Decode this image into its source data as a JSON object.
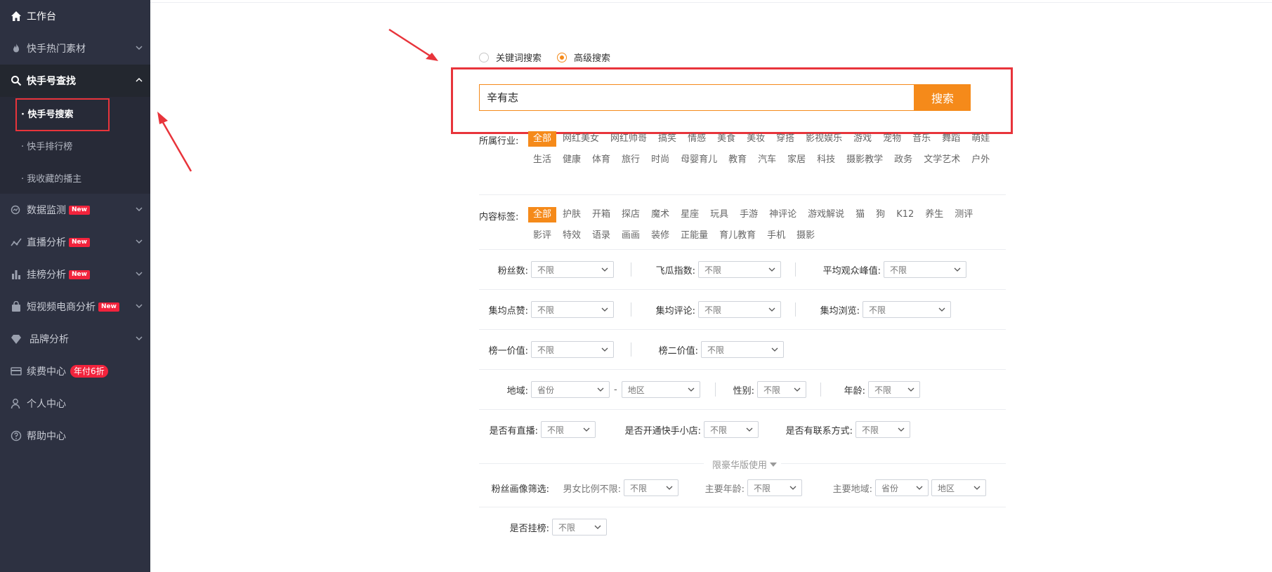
{
  "sidebar": {
    "items": [
      {
        "label": "工作台",
        "icon": "home-icon"
      },
      {
        "label": "快手热门素材",
        "icon": "fire-icon"
      },
      {
        "label": "快手号查找",
        "icon": "search-icon"
      },
      {
        "label": "数据监测",
        "icon": "monitor-icon",
        "badge": "New"
      },
      {
        "label": "直播分析",
        "icon": "trend-icon",
        "badge": "New"
      },
      {
        "label": "挂榜分析",
        "icon": "bar-chart-icon",
        "badge": "New"
      },
      {
        "label": "短视频电商分析",
        "icon": "shopping-bag-icon",
        "badge": "New"
      },
      {
        "label": "品牌分析",
        "icon": "diamond-icon"
      },
      {
        "label": "续费中心",
        "icon": "card-icon",
        "badge": "年付6折"
      },
      {
        "label": "个人中心",
        "icon": "user-icon"
      },
      {
        "label": "帮助中心",
        "icon": "help-icon"
      }
    ],
    "sub_items": [
      "· 快手号搜索",
      "· 快手排行榜",
      "· 我收藏的播主"
    ]
  },
  "search": {
    "mode_keyword": "关键词搜索",
    "mode_advanced": "高级搜索",
    "value": "辛有志",
    "button": "搜索"
  },
  "industry": {
    "label": "所属行业:",
    "tags": [
      "全部",
      "网红美女",
      "网红帅哥",
      "搞笑",
      "情感",
      "美食",
      "美妆",
      "穿搭",
      "影视娱乐",
      "游戏",
      "宠物",
      "音乐",
      "舞蹈",
      "萌娃",
      "生活",
      "健康",
      "体育",
      "旅行",
      "时尚",
      "母婴育儿",
      "教育",
      "汽车",
      "家居",
      "科技",
      "摄影教学",
      "政务",
      "文学艺术",
      "户外"
    ]
  },
  "content_tags": {
    "label": "内容标签:",
    "tags": [
      "全部",
      "护肤",
      "开箱",
      "探店",
      "魔术",
      "星座",
      "玩具",
      "手游",
      "神评论",
      "游戏解说",
      "猫",
      "狗",
      "K12",
      "养生",
      "测评",
      "影评",
      "特效",
      "语录",
      "画画",
      "装修",
      "正能量",
      "育儿教育",
      "手机",
      "摄影"
    ]
  },
  "filters": {
    "fans": "粉丝数:",
    "feigua_index": "飞瓜指数:",
    "avg_peak": "平均观众峰值:",
    "avg_likes": "集均点赞:",
    "avg_comments": "集均评论:",
    "avg_views": "集均浏览:",
    "rank1_value": "榜一价值:",
    "rank2_value": "榜二价值:",
    "region": "地域:",
    "gender": "性别:",
    "age": "年龄:",
    "has_live": "是否有直播:",
    "has_shop": "是否开通快手小店:",
    "has_contact": "是否有联系方式:",
    "fan_portrait": "粉丝画像筛选:",
    "gender_ratio": "男女比例不限:",
    "main_age": "主要年龄:",
    "main_region": "主要地域:",
    "on_rank": "是否挂榜:",
    "unlimited": "不限",
    "province": "省份",
    "area": "地区",
    "dash": "-"
  },
  "deluxe_note": "限豪华版使用",
  "colors": {
    "accent": "#f58a1a",
    "sidebar_bg": "#2d3141",
    "annotation_red": "#e8343b"
  }
}
